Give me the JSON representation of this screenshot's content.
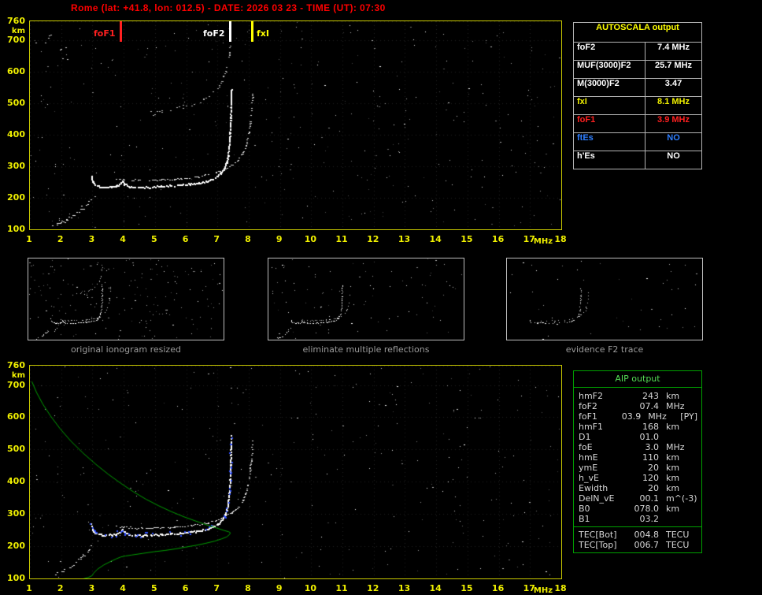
{
  "title": "Rome (lat: +41.8, lon: 012.5) - DATE: 2026 03 23 - TIME (UT): 07:30",
  "colors": {
    "title_red": "#ff0000",
    "axis_labels_yellow": "#f0f000",
    "plot_border_yellow": "#c8c800",
    "table_border_green": "#00a000",
    "foF1_red": "#ff2020",
    "fxI_yellow": "#ffff00",
    "ftEs_blue": "#2f7fff",
    "restored_trace_blue": "#3050ff",
    "profile_green": "#00a000"
  },
  "autoscala_table": {
    "header": "AUTOSCALA output",
    "rows": [
      {
        "label": "foF2",
        "value": "7.4 MHz",
        "color": "#ffffff"
      },
      {
        "label": "MUF(3000)F2",
        "value": "25.7 MHz",
        "color": "#ffffff"
      },
      {
        "label": "M(3000)F2",
        "value": "3.47",
        "color": "#ffffff"
      },
      {
        "label": "fxI",
        "value": "8.1 MHz",
        "color": "#f0f000"
      },
      {
        "label": "foF1",
        "value": "3.9 MHz",
        "color": "#ff2020"
      },
      {
        "label": "ftEs",
        "value": "NO",
        "color": "#2f7fff"
      },
      {
        "label": "h'Es",
        "value": "NO",
        "color": "#ffffff"
      }
    ]
  },
  "aip_table": {
    "header": "AIP output",
    "rows": [
      {
        "name": "hmF2",
        "value": "243",
        "unit": "km",
        "extra": ""
      },
      {
        "name": "foF2",
        "value": "07.4",
        "unit": "MHz",
        "extra": ""
      },
      {
        "name": "foF1",
        "value": "03.9",
        "unit": "MHz",
        "extra": "[PY]"
      },
      {
        "name": "hmF1",
        "value": "168",
        "unit": "km",
        "extra": ""
      },
      {
        "name": "D1",
        "value": "01.0",
        "unit": "",
        "extra": ""
      },
      {
        "name": "foE",
        "value": "3.0",
        "unit": "MHz",
        "extra": ""
      },
      {
        "name": "hmE",
        "value": "110",
        "unit": "km",
        "extra": ""
      },
      {
        "name": "ymE",
        "value": "20",
        "unit": "km",
        "extra": ""
      },
      {
        "name": "h_vE",
        "value": "120",
        "unit": "km",
        "extra": ""
      },
      {
        "name": "Ewidth",
        "value": "20",
        "unit": "km",
        "extra": ""
      },
      {
        "name": "DelN_vE",
        "value": "00.1",
        "unit": "m^(-3)",
        "extra": ""
      },
      {
        "name": "B0",
        "value": "078.0",
        "unit": "km",
        "extra": ""
      },
      {
        "name": "B1",
        "value": "03.2",
        "unit": "",
        "extra": ""
      }
    ],
    "tec_rows": [
      {
        "name": "TEC[Bot]",
        "value": "004.8",
        "unit": "TECU"
      },
      {
        "name": "TEC[Top]",
        "value": "006.7",
        "unit": "TECU"
      }
    ]
  },
  "thumbnails": [
    {
      "caption": "original ionogram resized"
    },
    {
      "caption": "eliminate multiple reflections"
    },
    {
      "caption": "evidence F2 trace"
    }
  ],
  "chart_data": [
    {
      "id": "main_ionogram",
      "type": "scatter",
      "title": "",
      "xlabel": "MHz",
      "ylabel": "km",
      "xlim": [
        1,
        18
      ],
      "ylim": [
        100,
        760
      ],
      "x_ticks": [
        1,
        2,
        3,
        4,
        5,
        6,
        7,
        8,
        9,
        10,
        11,
        12,
        13,
        14,
        15,
        16,
        17,
        18
      ],
      "y_ticks": [
        100,
        200,
        300,
        400,
        500,
        600,
        700,
        760
      ],
      "grid": "faint-dotted",
      "markers": [
        {
          "label": "foF1",
          "freq": 3.9,
          "color": "#ff2020",
          "label_side": "left"
        },
        {
          "label": "foF2",
          "freq": 7.4,
          "color": "#ffffff",
          "label_side": "left"
        },
        {
          "label": "fxI",
          "freq": 8.1,
          "color": "#ffff00",
          "label_side": "right"
        }
      ],
      "traces": {
        "e_trace": [
          [
            1.7,
            112
          ],
          [
            1.85,
            116
          ],
          [
            2.0,
            122
          ],
          [
            2.15,
            130
          ],
          [
            2.3,
            139
          ],
          [
            2.45,
            149
          ],
          [
            2.6,
            161
          ],
          [
            2.75,
            174
          ],
          [
            2.87,
            188
          ],
          [
            2.95,
            202
          ]
        ],
        "f_o_trace": [
          [
            2.95,
            270
          ],
          [
            3.0,
            252
          ],
          [
            3.08,
            243
          ],
          [
            3.2,
            238
          ],
          [
            3.4,
            236
          ],
          [
            3.6,
            236
          ],
          [
            3.75,
            238
          ],
          [
            3.87,
            244
          ],
          [
            3.94,
            253
          ],
          [
            4.02,
            244
          ],
          [
            4.15,
            238
          ],
          [
            4.35,
            235
          ],
          [
            4.6,
            235
          ],
          [
            4.9,
            236
          ],
          [
            5.2,
            238
          ],
          [
            5.5,
            240
          ],
          [
            5.8,
            242
          ],
          [
            6.1,
            245
          ],
          [
            6.4,
            249
          ],
          [
            6.65,
            254
          ],
          [
            6.85,
            261
          ],
          [
            7.0,
            270
          ],
          [
            7.1,
            280
          ],
          [
            7.2,
            294
          ],
          [
            7.28,
            313
          ],
          [
            7.33,
            338
          ],
          [
            7.37,
            370
          ],
          [
            7.39,
            408
          ],
          [
            7.41,
            455
          ],
          [
            7.42,
            505
          ],
          [
            7.43,
            545
          ]
        ],
        "f_x_trace": [
          [
            3.7,
            263
          ],
          [
            4.0,
            259
          ],
          [
            4.4,
            257
          ],
          [
            4.8,
            257
          ],
          [
            5.2,
            258
          ],
          [
            5.6,
            260
          ],
          [
            6.0,
            263
          ],
          [
            6.4,
            268
          ],
          [
            6.7,
            274
          ],
          [
            6.95,
            281
          ],
          [
            7.2,
            291
          ],
          [
            7.45,
            304
          ],
          [
            7.65,
            321
          ],
          [
            7.8,
            342
          ],
          [
            7.9,
            368
          ],
          [
            7.98,
            400
          ],
          [
            8.04,
            440
          ],
          [
            8.08,
            485
          ],
          [
            8.11,
            530
          ]
        ],
        "second_hop": [
          [
            4.85,
            468
          ],
          [
            5.2,
            474
          ],
          [
            5.55,
            481
          ],
          [
            5.9,
            489
          ],
          [
            6.25,
            499
          ],
          [
            6.55,
            512
          ],
          [
            6.8,
            528
          ],
          [
            7.0,
            548
          ],
          [
            7.15,
            575
          ],
          [
            7.27,
            612
          ],
          [
            7.36,
            655
          ],
          [
            7.42,
            700
          ]
        ],
        "scatter_patch": [
          [
            1.3,
            700
          ],
          [
            1.55,
            685
          ],
          [
            1.8,
            665
          ],
          [
            2.05,
            648
          ],
          [
            2.3,
            632
          ],
          [
            1.45,
            725
          ],
          [
            1.75,
            705
          ],
          [
            2.1,
            688
          ],
          [
            2.4,
            668
          ]
        ]
      }
    },
    {
      "id": "restored_ionogram_with_profile",
      "type": "scatter",
      "title": "",
      "xlabel": "MHz",
      "ylabel": "km",
      "xlim": [
        1,
        18
      ],
      "ylim": [
        100,
        760
      ],
      "x_ticks": [
        1,
        2,
        3,
        4,
        5,
        6,
        7,
        8,
        9,
        10,
        11,
        12,
        13,
        14,
        15,
        16,
        17,
        18
      ],
      "y_ticks": [
        100,
        200,
        300,
        400,
        500,
        600,
        700,
        760
      ],
      "grid": "faint-dotted",
      "markers": [],
      "restored_color": "#3050ff",
      "profile_color": "#00a000",
      "traces": {
        "e_trace": [
          [
            1.7,
            112
          ],
          [
            1.85,
            116
          ],
          [
            2.0,
            122
          ],
          [
            2.15,
            130
          ],
          [
            2.3,
            139
          ],
          [
            2.45,
            149
          ],
          [
            2.6,
            161
          ],
          [
            2.75,
            174
          ],
          [
            2.87,
            188
          ],
          [
            2.95,
            202
          ]
        ],
        "f_o_trace": [
          [
            2.95,
            270
          ],
          [
            3.0,
            252
          ],
          [
            3.08,
            243
          ],
          [
            3.2,
            238
          ],
          [
            3.4,
            236
          ],
          [
            3.6,
            236
          ],
          [
            3.75,
            238
          ],
          [
            3.87,
            244
          ],
          [
            3.94,
            253
          ],
          [
            4.02,
            244
          ],
          [
            4.15,
            238
          ],
          [
            4.35,
            235
          ],
          [
            4.6,
            235
          ],
          [
            4.9,
            236
          ],
          [
            5.2,
            238
          ],
          [
            5.5,
            240
          ],
          [
            5.8,
            242
          ],
          [
            6.1,
            245
          ],
          [
            6.4,
            249
          ],
          [
            6.65,
            254
          ],
          [
            6.85,
            261
          ],
          [
            7.0,
            270
          ],
          [
            7.1,
            280
          ],
          [
            7.2,
            294
          ],
          [
            7.28,
            313
          ],
          [
            7.33,
            338
          ],
          [
            7.37,
            370
          ],
          [
            7.39,
            408
          ],
          [
            7.41,
            455
          ],
          [
            7.42,
            505
          ],
          [
            7.43,
            545
          ]
        ],
        "f_x_trace": [
          [
            3.7,
            263
          ],
          [
            4.0,
            259
          ],
          [
            4.4,
            257
          ],
          [
            4.8,
            257
          ],
          [
            5.2,
            258
          ],
          [
            5.6,
            260
          ],
          [
            6.0,
            263
          ],
          [
            6.4,
            268
          ],
          [
            6.7,
            274
          ],
          [
            6.95,
            281
          ],
          [
            7.2,
            291
          ],
          [
            7.45,
            304
          ],
          [
            7.65,
            321
          ],
          [
            7.8,
            342
          ],
          [
            7.9,
            368
          ],
          [
            7.98,
            400
          ],
          [
            8.04,
            440
          ],
          [
            8.08,
            485
          ],
          [
            8.11,
            530
          ]
        ]
      },
      "profile": [
        [
          1.05,
          712
        ],
        [
          1.2,
          678
        ],
        [
          1.4,
          642
        ],
        [
          1.65,
          605
        ],
        [
          1.95,
          566
        ],
        [
          2.3,
          527
        ],
        [
          2.7,
          489
        ],
        [
          3.1,
          455
        ],
        [
          3.5,
          424
        ],
        [
          3.9,
          396
        ],
        [
          4.3,
          370
        ],
        [
          4.7,
          347
        ],
        [
          5.1,
          327
        ],
        [
          5.5,
          309
        ],
        [
          5.9,
          293
        ],
        [
          6.3,
          279
        ],
        [
          6.65,
          267
        ],
        [
          6.95,
          258
        ],
        [
          7.2,
          250
        ],
        [
          7.35,
          246
        ],
        [
          7.4,
          243
        ],
        [
          7.37,
          237
        ],
        [
          7.28,
          230
        ],
        [
          7.12,
          224
        ],
        [
          6.9,
          217
        ],
        [
          6.6,
          210
        ],
        [
          6.3,
          204
        ],
        [
          6.0,
          199
        ],
        [
          5.65,
          193
        ],
        [
          5.3,
          188
        ],
        [
          4.95,
          184
        ],
        [
          4.6,
          179
        ],
        [
          4.25,
          174
        ],
        [
          4.05,
          171
        ],
        [
          3.9,
          168
        ],
        [
          3.75,
          162
        ],
        [
          3.55,
          153
        ],
        [
          3.35,
          143
        ],
        [
          3.15,
          130
        ],
        [
          3.02,
          117
        ],
        [
          2.98,
          110
        ],
        [
          2.85,
          104
        ],
        [
          2.65,
          99
        ],
        [
          2.4,
          95
        ],
        [
          2.1,
          92
        ],
        [
          1.8,
          90
        ]
      ]
    }
  ]
}
